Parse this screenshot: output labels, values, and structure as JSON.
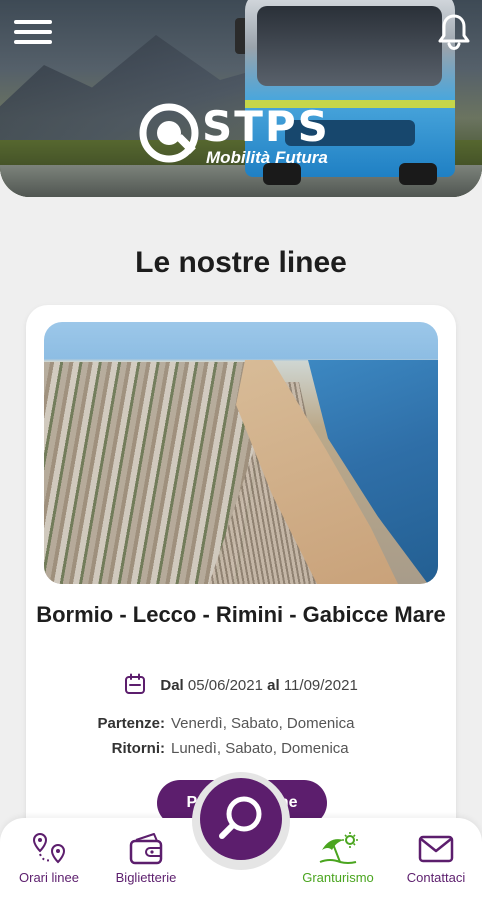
{
  "header": {
    "brand_name": "STPS",
    "brand_tagline": "Mobilità Futura",
    "menu_icon": "hamburger-menu-icon",
    "notifications_icon": "bell-icon"
  },
  "page_title": "Le nostre linee",
  "line_card": {
    "route_name": "Bormio - Lecco - Rimini - Gabicce Mare",
    "date_from_label": "Dal",
    "date_from": "05/06/2021",
    "date_to_label": "al",
    "date_to": "11/09/2021",
    "departures_label": "Partenze:",
    "departures_value": "Venerdì, Sabato, Domenica",
    "returns_label": "Ritorni:",
    "returns_value": "Lunedì, Sabato, Domenica",
    "book_button_label": "Prenota online",
    "photo_icon": "beach-photo"
  },
  "bottom_nav": {
    "items": [
      {
        "label": "Orari linee",
        "icon": "route-pins-icon"
      },
      {
        "label": "Biglietterie",
        "icon": "wallet-icon"
      },
      {
        "label": "Granturismo",
        "icon": "beach-umbrella-icon",
        "active": true
      },
      {
        "label": "Contattaci",
        "icon": "mail-icon"
      }
    ],
    "fab_icon": "search-icon"
  },
  "colors": {
    "brand_purple": "#5c1e6d",
    "active_green": "#4aa51f",
    "background": "#efefef"
  }
}
